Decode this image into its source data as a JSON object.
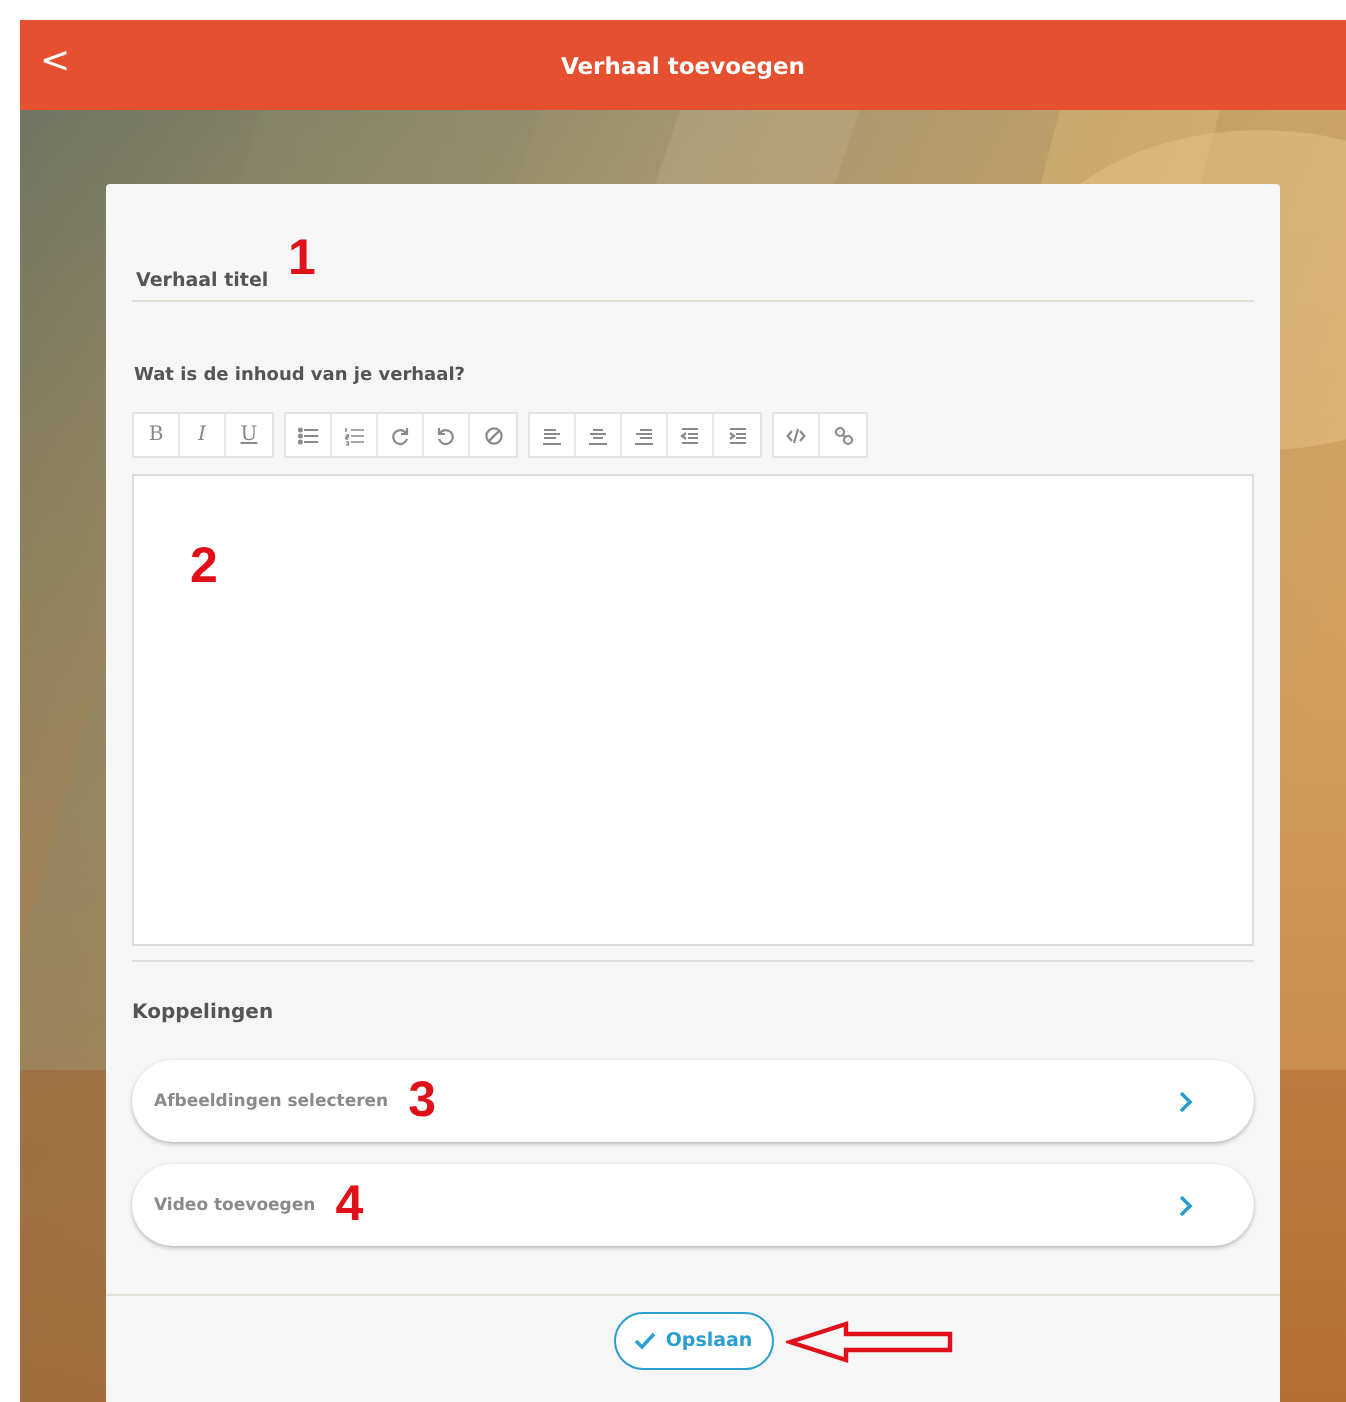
{
  "header": {
    "title": "Verhaal toevoegen",
    "back_icon": "<"
  },
  "title_field": {
    "placeholder": "Verhaal titel",
    "annotation": "1"
  },
  "content": {
    "label": "Wat is de inhoud van je verhaal?",
    "text_buttons": [
      "B",
      "I",
      "U"
    ],
    "annotation": "2"
  },
  "links": {
    "heading": "Koppelingen",
    "items": [
      {
        "label": "Afbeeldingen selecteren",
        "annotation": "3"
      },
      {
        "label": "Video toevoegen",
        "annotation": "4"
      }
    ]
  },
  "save_button": {
    "label": "Opslaan",
    "annotated": true
  }
}
